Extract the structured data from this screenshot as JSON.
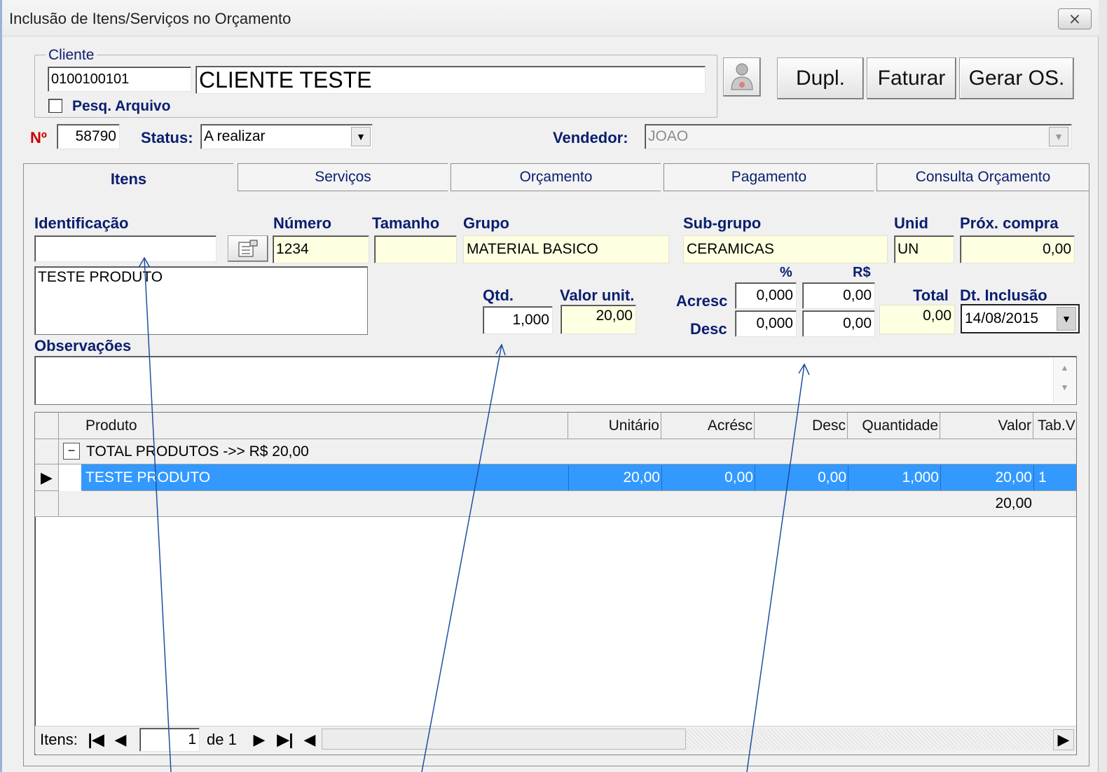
{
  "window": {
    "title": "Inclusão de Itens/Serviços no Orçamento",
    "close_glyph": "⨯"
  },
  "cliente": {
    "group_label": "Cliente",
    "code": "0100100101",
    "name": "CLIENTE TESTE",
    "pesq_label": "Pesq. Arquivo",
    "pesq_checked": false
  },
  "buttons": {
    "dupl": "Dupl.",
    "faturar": "Faturar",
    "gerar_os": "Gerar OS."
  },
  "header": {
    "numero_label": "Nº",
    "numero": "58790",
    "status_label": "Status:",
    "status": "A realizar",
    "vendedor_label": "Vendedor:",
    "vendedor": "JOAO"
  },
  "tabs": [
    "Itens",
    "Serviços",
    "Orçamento",
    "Pagamento",
    "Consulta Orçamento"
  ],
  "form": {
    "identificacao_label": "Identificação",
    "identificacao": "",
    "numero_label": "Número",
    "numero": "1234",
    "tamanho_label": "Tamanho",
    "tamanho": "",
    "grupo_label": "Grupo",
    "grupo": "MATERIAL BASICO",
    "subgrupo_label": "Sub-grupo",
    "subgrupo": "CERAMICAS",
    "unid_label": "Unid",
    "unid": "UN",
    "prox_compra_label": "Próx. compra",
    "prox_compra": "0,00",
    "descricao": "TESTE PRODUTO",
    "qtd_label": "Qtd.",
    "qtd": "1,000",
    "valor_unit_label": "Valor unit.",
    "valor_unit": "20,00",
    "pct_label": "%",
    "rs_label": "R$",
    "acresc_label": "Acresc",
    "acresc_pct": "0,000",
    "acresc_rs": "0,00",
    "desc_label": "Desc",
    "desc_pct": "0,000",
    "desc_rs": "0,00",
    "total_label": "Total",
    "total": "0,00",
    "dt_inclusao_label": "Dt. Inclusão",
    "dt_inclusao": "14/08/2015",
    "observacoes_label": "Observações",
    "observacoes": ""
  },
  "grid": {
    "columns": [
      "Produto",
      "Unitário",
      "Acrésc",
      "Desc",
      "Quantidade",
      "Valor",
      "Tab.V"
    ],
    "group_row": "TOTAL PRODUTOS ->> R$ 20,00",
    "group_toggle": "−",
    "rows": [
      {
        "produto": "TESTE PRODUTO",
        "unitario": "20,00",
        "acresc": "0,00",
        "desc": "0,00",
        "quantidade": "1,000",
        "valor": "20,00",
        "tabv": "1"
      }
    ],
    "footer_total": "20,00"
  },
  "navigator": {
    "label": "Itens:",
    "current": "1",
    "of_label": "de 1"
  },
  "colors": {
    "selection": "#3399ff",
    "label_blue": "#0a1e6e",
    "required_red": "#cc0000",
    "annotation_arrow": "#1e4fa0"
  }
}
